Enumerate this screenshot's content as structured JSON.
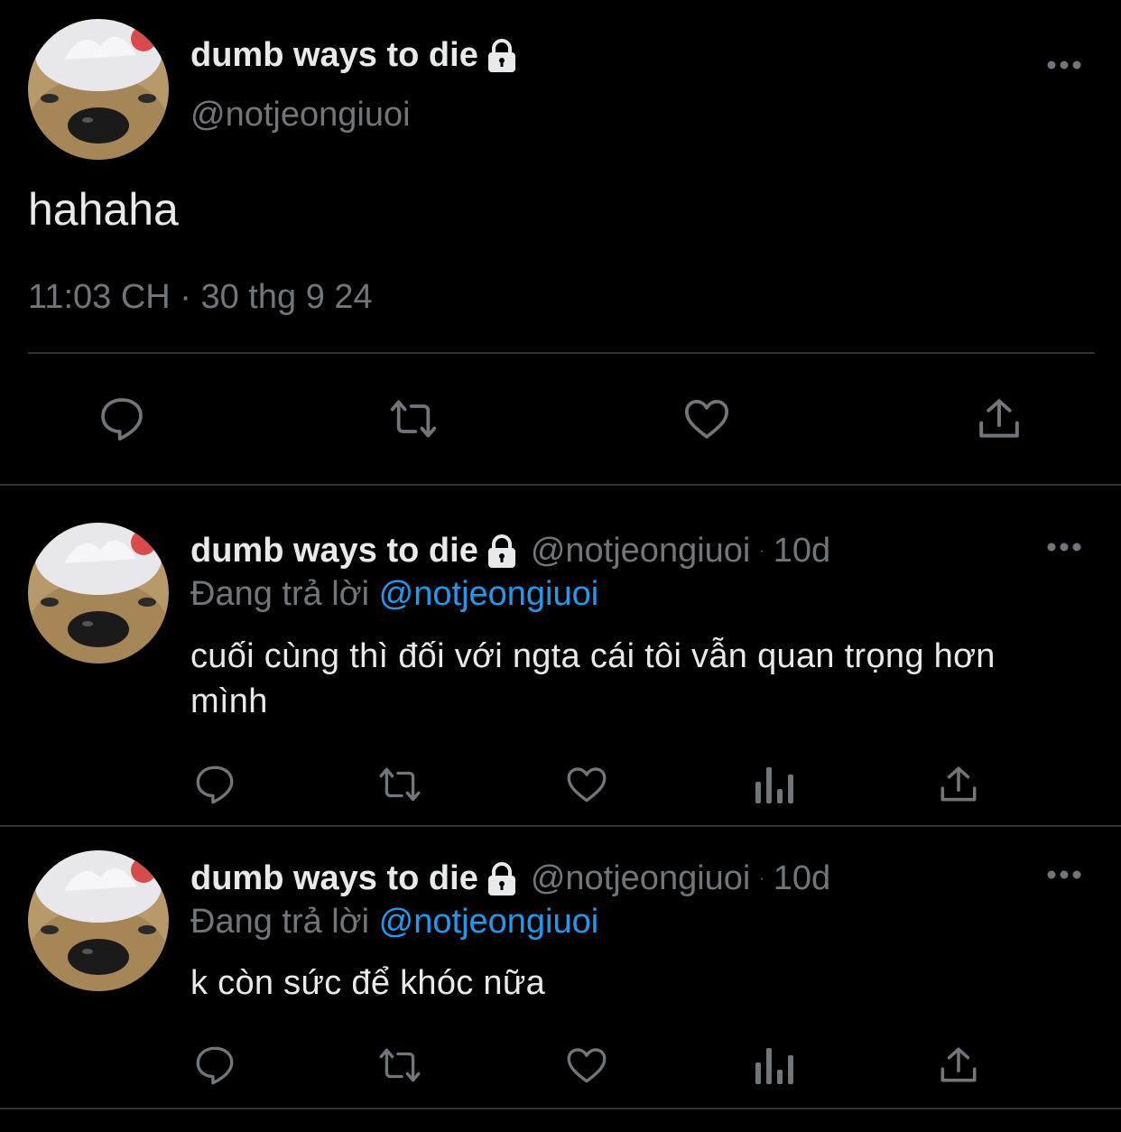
{
  "main_tweet": {
    "display_name": "dumb ways to die",
    "handle": "@notjeongiuoi",
    "text": "hahaha",
    "timestamp": "11:03 CH · 30 thg 9 24"
  },
  "replies": [
    {
      "display_name": "dumb ways to die",
      "handle": "@notjeongiuoi",
      "time": "10d",
      "replying_prefix": "Đang trả lời",
      "replying_to": "@notjeongiuoi",
      "text": "cuối cùng thì đối với ngta cái tôi vẫn quan trọng hơn mình"
    },
    {
      "display_name": "dumb ways to die",
      "handle": "@notjeongiuoi",
      "time": "10d",
      "replying_prefix": "Đang trả lời",
      "replying_to": "@notjeongiuoi",
      "text": "k còn sức để khóc nữa"
    }
  ],
  "icons": {
    "reply": "comment-icon",
    "retweet": "retweet-icon",
    "like": "heart-icon",
    "views": "analytics-icon",
    "share": "share-icon",
    "more": "more-icon",
    "protected": "lock-icon"
  },
  "colors": {
    "background": "#000000",
    "text": "#e7e9ea",
    "secondary": "#71767b",
    "link": "#1d9bf0",
    "border": "#2f3336"
  }
}
